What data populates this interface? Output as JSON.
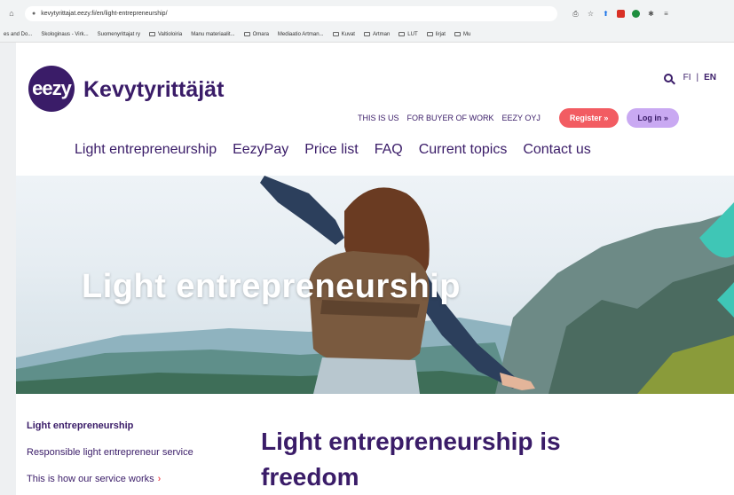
{
  "browser": {
    "url": "kevytyrittajat.eezy.fi/en/light-entrepreneurship/",
    "bookmarks": [
      "es and Do...",
      "Skologinaus - Virk...",
      "Suomenyrittajat ry",
      "Valtioloiria",
      "Manu materiaalit...",
      "Omara",
      "Mediaatio Artman...",
      "Kuvat",
      "Artman",
      "LUT",
      "Iirjat",
      "Mu"
    ]
  },
  "header": {
    "logo_text": "eezy",
    "brand_name": "Kevytyrittäjät",
    "lang_fi": "FI",
    "lang_separator": "|",
    "lang_en": "EN",
    "utility_links": [
      "THIS IS US",
      "FOR BUYER OF WORK",
      "EEZY OYJ"
    ],
    "register_label": "Register »",
    "login_label": "Log in »"
  },
  "main_nav": {
    "items": [
      "Light entrepreneurship",
      "EezyPay",
      "Price list",
      "FAQ",
      "Current topics",
      "Contact us"
    ]
  },
  "hero": {
    "title": "Light entrepreneurship"
  },
  "side_nav": {
    "items": [
      "Light entrepreneurship",
      "Responsible light entrepreneur service",
      "This is how our service works"
    ],
    "arrow": "›"
  },
  "content": {
    "title": "Light entrepreneurship is freedom"
  },
  "colors": {
    "brand": "#3a1c68",
    "register": "#f25c62",
    "login": "#c9a9f2"
  }
}
